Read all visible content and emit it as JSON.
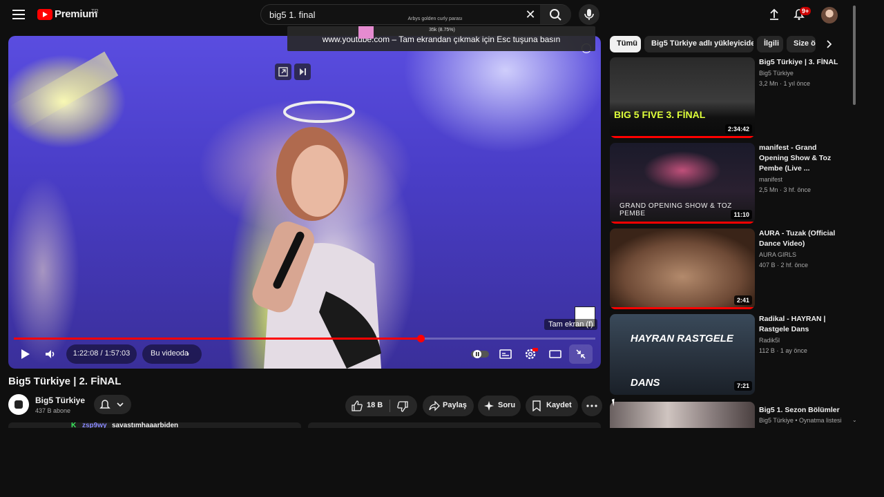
{
  "header": {
    "logo_text": "Premium",
    "country": "TR",
    "search_value": "big5 1. final",
    "notification_count": "9+"
  },
  "overlay": {
    "small_title": "Arbys golden curly parası",
    "small_percent": "35k (8.75%)",
    "fullscreen_hint": "www.youtube.com – Tam ekrandan çıkmak için Esc tuşuna basın"
  },
  "player": {
    "current_time": "1:22:08",
    "duration": "1:57:03",
    "time_display": "1:22:08 / 1:57:03",
    "progress": 0.7,
    "in_video_label": "Bu videoda",
    "fullscreen_tooltip": "Tam ekran (f)"
  },
  "video": {
    "title": "Big5 Türkiye | 2. FİNAL",
    "channel_name": "Big5 Türkiye",
    "subscribers": "437 B abone",
    "likes": "18 B",
    "share_label": "Paylaş",
    "ask_label": "Soru",
    "save_label": "Kaydet"
  },
  "chat": {
    "user": "zsp9wy",
    "message": "savastımhaaarbiden"
  },
  "chips": [
    "Tümü",
    "Big5 Türkiye adlı yükleyiciden",
    "İlgili",
    "Size ö"
  ],
  "related": [
    {
      "title": "Big5 Türkiye | 3. FİNAL",
      "channel": "Big5 Türkiye",
      "meta": "3,2 Mn · 1 yıl önce",
      "duration": "2:34:42",
      "thumb_text": "BIG 5 FIVE 3. FİNAL",
      "progress": 1.0
    },
    {
      "title": "manifest - Grand Opening Show & Toz Pembe (Live ...",
      "channel": "manifest",
      "meta": "2,5 Mn · 3 hf. önce",
      "duration": "11:10",
      "thumb_text": "GRAND OPENING SHOW & TOZ PEMBE",
      "progress": 1.0
    },
    {
      "title": "AURA - Tuzak (Official Dance Video)",
      "channel": "AURA GIRLS",
      "meta": "407 B · 2 hf. önce",
      "duration": "2:41",
      "thumb_text": "",
      "progress": 1.0
    },
    {
      "title": "Radikal - HAYRAN | Rastgele Dans",
      "channel": "Radik5l",
      "meta": "112 B · 1 ay önce",
      "duration": "7:21",
      "thumb_text": "HAYRAN RASTGELE DANS",
      "progress": 0.0
    },
    {
      "title": "Big5 1. Sezon Bölümler",
      "channel": "Big5 Türkiye • Oynatma listesi",
      "meta": "",
      "duration": "",
      "thumb_text": "",
      "progress": 0.0
    }
  ],
  "colors": {
    "accent": "#ff0000",
    "bg": "#0f0f0f",
    "chip_bg": "#272727"
  }
}
